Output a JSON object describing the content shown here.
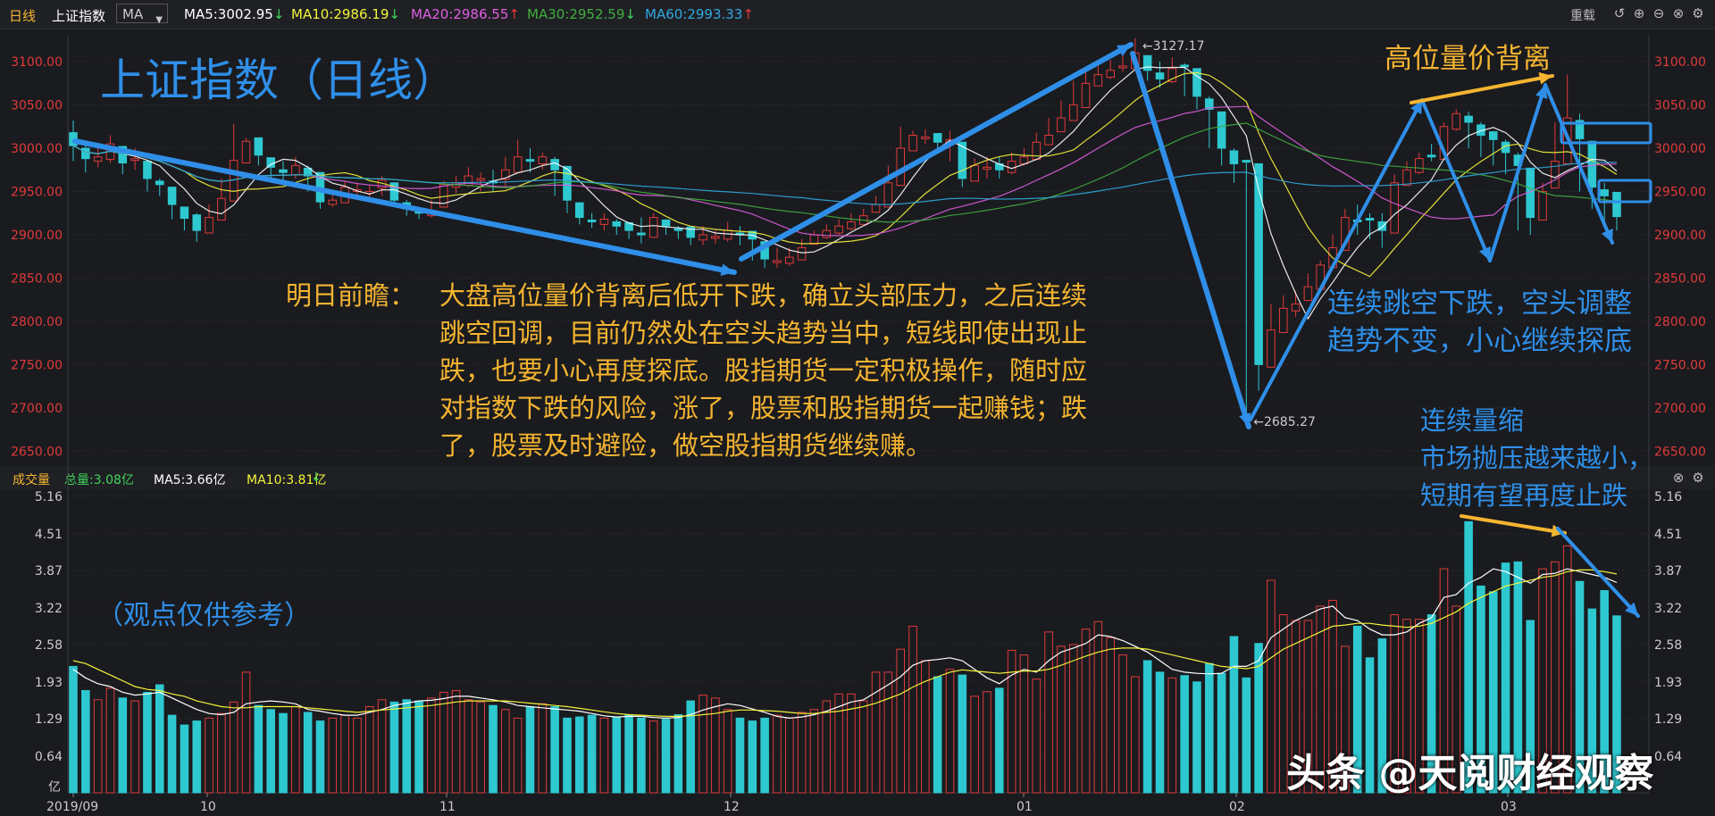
{
  "header": {
    "period": "日线",
    "index_name": "上证指数",
    "indicator": "MA",
    "ma_values": [
      {
        "label": "MA5:3002.95",
        "arrow": "↓",
        "color": "#ffffff"
      },
      {
        "label": "MA10:2986.19",
        "arrow": "↓",
        "color": "#f3f33a"
      },
      {
        "label": "MA20:2986.55",
        "arrow": "↑",
        "color": "#e05ee0"
      },
      {
        "label": "MA30:2952.59",
        "arrow": "↓",
        "color": "#3fae3f"
      },
      {
        "label": "MA60:2993.33",
        "arrow": "↑",
        "color": "#2fa8e0"
      }
    ],
    "reset_label": "重载"
  },
  "volume_header": {
    "title": "成交量",
    "total": "总量:3.08亿",
    "ma5": "MA5:3.66亿",
    "ma10": "MA10:3.81亿",
    "arrow": "↓"
  },
  "annotations": {
    "chart_title": "上证指数（日线）",
    "top_right": "高位量价背离",
    "mid_right_1": "连续跳空下跌，空头调整",
    "mid_right_2": "趋势不变，小心继续探底",
    "vol_note_1": "连续量缩",
    "vol_note_2": "市场抛压越来越小，",
    "vol_note_3": "短期有望再度止跌",
    "disclaimer": "（观点仅供参考）",
    "forecast_label": "明日前瞻：",
    "forecast_lines": [
      "大盘高位量价背离后低开下跌，确立头部压力，之后连续",
      "跳空回调，目前仍然处在空头趋势当中，短线即使出现止",
      "跌，也要小心再度探底。股指期货一定积极操作，随时应",
      "对指数下跌的风险，涨了，股票和股指期货一起赚钱；跌",
      "了，股票及时避险，做空股指期货继续赚。"
    ],
    "watermark": "头条 @天阅财经观察"
  },
  "colors": {
    "up": "#e03a3a",
    "down": "#2ec8d0",
    "blue_text": "#2f8fe8",
    "orange_text": "#f5b531"
  },
  "chart_data": [
    {
      "type": "candlestick",
      "title": "上证指数（日线）",
      "price_ticks": [
        "3100.00",
        "3050.00",
        "3000.00",
        "2950.00",
        "2900.00",
        "2850.00",
        "2800.00",
        "2750.00",
        "2700.00",
        "2650.00"
      ],
      "ylim": [
        2640,
        3130
      ],
      "high_label": "3127.17",
      "low_label": "2685.27",
      "x_ticks": [
        "2019/09",
        "10",
        "11",
        "12",
        "01",
        "02",
        "03"
      ],
      "ma_series": [
        "MA5",
        "MA10",
        "MA20",
        "MA30",
        "MA60"
      ],
      "closes": [
        3003,
        2988,
        2990,
        3005,
        2983,
        2988,
        2965,
        2958,
        2935,
        2919,
        2905,
        2920,
        2942,
        2986,
        3008,
        2992,
        2978,
        2972,
        2980,
        2968,
        2938,
        2940,
        2955,
        2952,
        2950,
        2963,
        2940,
        2930,
        2925,
        2928,
        2958,
        2960,
        2968,
        2965,
        2960,
        2975,
        2990,
        2985,
        2990,
        2975,
        2940,
        2920,
        2915,
        2918,
        2910,
        2905,
        2900,
        2920,
        2910,
        2905,
        2897,
        2900,
        2898,
        2905,
        2900,
        2895,
        2872,
        2870,
        2874,
        2885,
        2900,
        2905,
        2910,
        2915,
        2922,
        2935,
        2960,
        3000,
        3015,
        3013,
        3007,
        3010,
        2965,
        2980,
        2978,
        2975,
        2985,
        2990,
        3007,
        3015,
        3035,
        3050,
        3075,
        3085,
        3090,
        3095,
        3110,
        3090,
        3080,
        3092,
        3095,
        3060,
        3045,
        3000,
        2982,
        2985,
        2750,
        2790,
        2815,
        2820,
        2840,
        2865,
        2885,
        2920,
        2915,
        2918,
        2905,
        2960,
        2975,
        2988,
        2990,
        3025,
        3040,
        3030,
        3015,
        3010,
        2995,
        2980,
        2920,
        2950,
        2985,
        3035,
        3011,
        2955,
        2945,
        2921
      ],
      "lows": [
        2985,
        2972,
        2978,
        2983,
        2970,
        2975,
        2950,
        2945,
        2918,
        2905,
        2892,
        2902,
        2930,
        2980,
        2985,
        2980,
        2965,
        2962,
        2965,
        2950,
        2930,
        2932,
        2940,
        2942,
        2942,
        2945,
        2932,
        2922,
        2918,
        2920,
        2938,
        2948,
        2955,
        2950,
        2950,
        2955,
        2975,
        2972,
        2975,
        2945,
        2925,
        2912,
        2908,
        2905,
        2900,
        2895,
        2890,
        2898,
        2900,
        2895,
        2888,
        2888,
        2890,
        2892,
        2888,
        2870,
        2862,
        2862,
        2864,
        2875,
        2890,
        2895,
        2900,
        2905,
        2912,
        2925,
        2945,
        2985,
        3000,
        3005,
        2995,
        2985,
        2955,
        2962,
        2965,
        2965,
        2970,
        2980,
        2990,
        3005,
        3025,
        3040,
        3060,
        3075,
        3080,
        3088,
        3098,
        3078,
        3070,
        3075,
        3060,
        3045,
        3000,
        2980,
        2960,
        2685,
        2720,
        2760,
        2790,
        2805,
        2825,
        2850,
        2870,
        2900,
        2900,
        2895,
        2885,
        2945,
        2960,
        2970,
        2985,
        3015,
        3020,
        3000,
        2990,
        2980,
        2970,
        2905,
        2900,
        2930,
        2970,
        3000,
        2950,
        2930,
        2910,
        2905
      ],
      "highs": [
        3032,
        3005,
        3005,
        3015,
        3000,
        3000,
        2975,
        2965,
        2955,
        2930,
        2925,
        2935,
        2965,
        3028,
        3012,
        3000,
        2985,
        2985,
        2990,
        2980,
        2950,
        2950,
        2962,
        2960,
        2958,
        2968,
        2958,
        2940,
        2932,
        2940,
        2962,
        2968,
        2978,
        2972,
        2975,
        2990,
        3010,
        3000,
        2995,
        2990,
        2975,
        2935,
        2925,
        2925,
        2918,
        2912,
        2920,
        2925,
        2918,
        2910,
        2905,
        2910,
        2905,
        2915,
        2910,
        2902,
        2880,
        2885,
        2885,
        2895,
        2905,
        2912,
        2918,
        2925,
        2930,
        2945,
        2980,
        3025,
        3020,
        3022,
        3015,
        3020,
        2998,
        2988,
        2990,
        2990,
        2995,
        3000,
        3018,
        3035,
        3055,
        3078,
        3090,
        3100,
        3102,
        3110,
        3127,
        3100,
        3100,
        3105,
        3098,
        3072,
        3060,
        3035,
        3000,
        2985,
        2800,
        2820,
        2830,
        2835,
        2855,
        2870,
        2900,
        2930,
        2935,
        2925,
        2925,
        2970,
        2985,
        2995,
        3005,
        3030,
        3045,
        3042,
        3030,
        3020,
        3010,
        2995,
        2975,
        2960,
        3030,
        3085,
        3040,
        3005,
        2960,
        2935
      ]
    },
    {
      "type": "bar",
      "title": "成交量",
      "unit": "亿",
      "y_ticks": [
        "5.16",
        "4.51",
        "3.87",
        "3.22",
        "2.58",
        "1.93",
        "1.29",
        "0.64"
      ],
      "ylim": [
        0,
        5.16
      ],
      "values": [
        2.2,
        1.78,
        1.62,
        1.82,
        1.65,
        1.6,
        1.75,
        1.88,
        1.35,
        1.18,
        1.25,
        1.3,
        1.38,
        1.58,
        2.1,
        1.52,
        1.45,
        1.38,
        1.5,
        1.4,
        1.25,
        1.3,
        1.35,
        1.3,
        1.5,
        1.62,
        1.58,
        1.62,
        1.6,
        1.65,
        1.75,
        1.78,
        1.62,
        1.58,
        1.52,
        1.45,
        1.3,
        1.5,
        1.55,
        1.5,
        1.3,
        1.32,
        1.35,
        1.3,
        1.32,
        1.36,
        1.3,
        1.25,
        1.28,
        1.36,
        1.6,
        1.7,
        1.65,
        1.45,
        1.3,
        1.25,
        1.3,
        1.35,
        1.3,
        1.4,
        1.45,
        1.6,
        1.72,
        1.72,
        1.6,
        2.1,
        2.1,
        2.5,
        2.9,
        2.3,
        2.02,
        2.15,
        2.05,
        1.68,
        1.76,
        1.82,
        2.48,
        2.4,
        1.98,
        2.8,
        2.55,
        2.58,
        2.85,
        2.98,
        2.7,
        2.4,
        2.02,
        2.3,
        2.1,
        2.0,
        2.04,
        1.93,
        2.25,
        2.08,
        2.72,
        2.0,
        2.6,
        3.7,
        3.1,
        3.0,
        3.0,
        3.25,
        3.35,
        2.55,
        2.9,
        2.35,
        2.68,
        3.1,
        3.02,
        3.02,
        3.1,
        3.9,
        3.25,
        4.72,
        3.6,
        3.5,
        4.0,
        4.02,
        3.0,
        3.9,
        4.02,
        4.3,
        3.68,
        3.2,
        3.52,
        3.08
      ],
      "ma5": [
        2.15,
        2.0,
        1.9,
        1.85,
        1.75,
        1.7,
        1.72,
        1.75,
        1.65,
        1.55,
        1.45,
        1.38,
        1.36,
        1.4,
        1.55,
        1.58,
        1.6,
        1.58,
        1.55,
        1.45,
        1.42,
        1.38,
        1.35,
        1.35,
        1.4,
        1.45,
        1.52,
        1.56,
        1.6,
        1.61,
        1.64,
        1.68,
        1.68,
        1.65,
        1.62,
        1.58,
        1.52,
        1.5,
        1.48,
        1.46,
        1.44,
        1.42,
        1.38,
        1.34,
        1.32,
        1.33,
        1.33,
        1.31,
        1.3,
        1.31,
        1.36,
        1.44,
        1.5,
        1.55,
        1.52,
        1.46,
        1.4,
        1.33,
        1.3,
        1.32,
        1.36,
        1.42,
        1.5,
        1.58,
        1.62,
        1.75,
        1.88,
        2.02,
        2.22,
        2.3,
        2.32,
        2.35,
        2.3,
        2.15,
        2.0,
        1.9,
        2.05,
        2.15,
        2.1,
        2.3,
        2.45,
        2.52,
        2.6,
        2.75,
        2.72,
        2.65,
        2.55,
        2.45,
        2.3,
        2.15,
        2.1,
        2.08,
        2.07,
        2.08,
        2.2,
        2.2,
        2.3,
        2.7,
        2.85,
        3.0,
        3.1,
        3.2,
        3.25,
        3.05,
        3.0,
        2.85,
        2.75,
        2.75,
        2.8,
        2.95,
        3.05,
        3.4,
        3.45,
        3.65,
        3.75,
        3.9,
        3.85,
        3.75,
        3.65,
        3.8,
        3.82,
        3.9,
        3.85,
        3.8,
        3.75,
        3.66
      ],
      "ma10": [
        2.3,
        2.25,
        2.15,
        2.05,
        1.95,
        1.85,
        1.8,
        1.78,
        1.72,
        1.68,
        1.6,
        1.55,
        1.5,
        1.48,
        1.48,
        1.5,
        1.5,
        1.5,
        1.5,
        1.48,
        1.46,
        1.44,
        1.42,
        1.4,
        1.42,
        1.44,
        1.46,
        1.48,
        1.5,
        1.52,
        1.55,
        1.58,
        1.6,
        1.6,
        1.6,
        1.6,
        1.58,
        1.56,
        1.54,
        1.52,
        1.5,
        1.47,
        1.44,
        1.41,
        1.38,
        1.36,
        1.35,
        1.34,
        1.33,
        1.33,
        1.34,
        1.36,
        1.38,
        1.42,
        1.44,
        1.44,
        1.43,
        1.42,
        1.4,
        1.38,
        1.38,
        1.4,
        1.42,
        1.46,
        1.5,
        1.56,
        1.64,
        1.72,
        1.84,
        1.94,
        2.02,
        2.1,
        2.14,
        2.12,
        2.1,
        2.08,
        2.1,
        2.12,
        2.12,
        2.15,
        2.22,
        2.3,
        2.38,
        2.45,
        2.5,
        2.52,
        2.52,
        2.5,
        2.45,
        2.4,
        2.35,
        2.3,
        2.25,
        2.2,
        2.18,
        2.16,
        2.2,
        2.35,
        2.5,
        2.6,
        2.7,
        2.8,
        2.9,
        2.92,
        2.95,
        2.95,
        2.92,
        2.9,
        2.88,
        2.9,
        2.95,
        3.05,
        3.15,
        3.3,
        3.4,
        3.5,
        3.6,
        3.65,
        3.7,
        3.75,
        3.78,
        3.85,
        3.88,
        3.88,
        3.85,
        3.81
      ]
    }
  ]
}
